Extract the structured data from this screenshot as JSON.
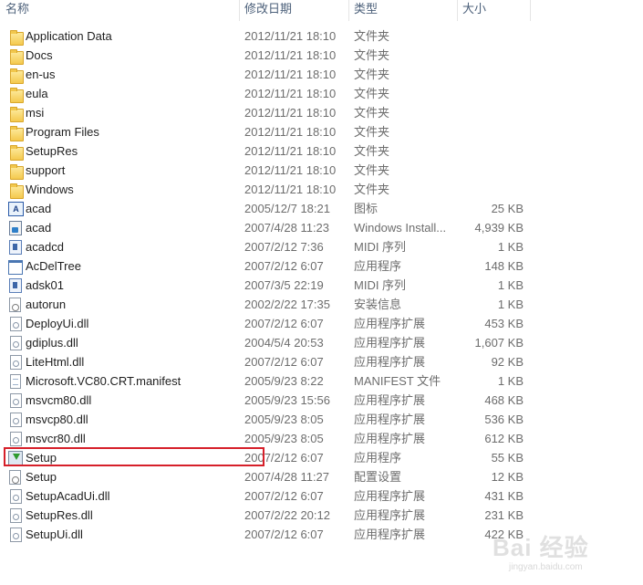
{
  "columns": {
    "name": "名称",
    "date": "修改日期",
    "type": "类型",
    "size": "大小"
  },
  "files": [
    {
      "name": "Application Data",
      "date": "2012/11/21 18:10",
      "type": "文件夹",
      "size": "",
      "icon": "folder-icon"
    },
    {
      "name": "Docs",
      "date": "2012/11/21 18:10",
      "type": "文件夹",
      "size": "",
      "icon": "folder-icon"
    },
    {
      "name": "en-us",
      "date": "2012/11/21 18:10",
      "type": "文件夹",
      "size": "",
      "icon": "folder-icon"
    },
    {
      "name": "eula",
      "date": "2012/11/21 18:10",
      "type": "文件夹",
      "size": "",
      "icon": "folder-icon"
    },
    {
      "name": "msi",
      "date": "2012/11/21 18:10",
      "type": "文件夹",
      "size": "",
      "icon": "folder-icon"
    },
    {
      "name": "Program Files",
      "date": "2012/11/21 18:10",
      "type": "文件夹",
      "size": "",
      "icon": "folder-icon"
    },
    {
      "name": "SetupRes",
      "date": "2012/11/21 18:10",
      "type": "文件夹",
      "size": "",
      "icon": "folder-icon"
    },
    {
      "name": "support",
      "date": "2012/11/21 18:10",
      "type": "文件夹",
      "size": "",
      "icon": "folder-icon"
    },
    {
      "name": "Windows",
      "date": "2012/11/21 18:10",
      "type": "文件夹",
      "size": "",
      "icon": "folder-icon"
    },
    {
      "name": "acad",
      "date": "2005/12/7 18:21",
      "type": "图标",
      "size": "25 KB",
      "icon": "acad-icon"
    },
    {
      "name": "acad",
      "date": "2007/4/28 11:23",
      "type": "Windows Install...",
      "size": "4,939 KB",
      "icon": "installer-icon"
    },
    {
      "name": "acadcd",
      "date": "2007/2/12 7:36",
      "type": "MIDI 序列",
      "size": "1 KB",
      "icon": "midi-icon"
    },
    {
      "name": "AcDelTree",
      "date": "2007/2/12 6:07",
      "type": "应用程序",
      "size": "148 KB",
      "icon": "application-icon"
    },
    {
      "name": "adsk01",
      "date": "2007/3/5 22:19",
      "type": "MIDI 序列",
      "size": "1 KB",
      "icon": "midi-icon"
    },
    {
      "name": "autorun",
      "date": "2002/2/22 17:35",
      "type": "安装信息",
      "size": "1 KB",
      "icon": "setup-info-icon"
    },
    {
      "name": "DeployUi.dll",
      "date": "2007/2/12 6:07",
      "type": "应用程序扩展",
      "size": "453 KB",
      "icon": "dll-icon"
    },
    {
      "name": "gdiplus.dll",
      "date": "2004/5/4 20:53",
      "type": "应用程序扩展",
      "size": "1,607 KB",
      "icon": "dll-icon"
    },
    {
      "name": "LiteHtml.dll",
      "date": "2007/2/12 6:07",
      "type": "应用程序扩展",
      "size": "92 KB",
      "icon": "dll-icon"
    },
    {
      "name": "Microsoft.VC80.CRT.manifest",
      "date": "2005/9/23 8:22",
      "type": "MANIFEST 文件",
      "size": "1 KB",
      "icon": "document-icon"
    },
    {
      "name": "msvcm80.dll",
      "date": "2005/9/23 15:56",
      "type": "应用程序扩展",
      "size": "468 KB",
      "icon": "dll-icon"
    },
    {
      "name": "msvcp80.dll",
      "date": "2005/9/23 8:05",
      "type": "应用程序扩展",
      "size": "536 KB",
      "icon": "dll-icon"
    },
    {
      "name": "msvcr80.dll",
      "date": "2005/9/23 8:05",
      "type": "应用程序扩展",
      "size": "612 KB",
      "icon": "dll-icon"
    },
    {
      "name": "Setup",
      "date": "2007/2/12 6:07",
      "type": "应用程序",
      "size": "55 KB",
      "icon": "setup-icon"
    },
    {
      "name": "Setup",
      "date": "2007/4/28 11:27",
      "type": "配置设置",
      "size": "12 KB",
      "icon": "config-icon"
    },
    {
      "name": "SetupAcadUi.dll",
      "date": "2007/2/12 6:07",
      "type": "应用程序扩展",
      "size": "431 KB",
      "icon": "dll-icon"
    },
    {
      "name": "SetupRes.dll",
      "date": "2007/2/22 20:12",
      "type": "应用程序扩展",
      "size": "231 KB",
      "icon": "dll-icon"
    },
    {
      "name": "SetupUi.dll",
      "date": "2007/2/12 6:07",
      "type": "应用程序扩展",
      "size": "422 KB",
      "icon": "dll-icon"
    }
  ],
  "watermark": {
    "main": "Bai 经验",
    "sub": "jingyan.baidu.com"
  },
  "colors": {
    "highlight_border": "#d6202a",
    "header_text": "#4c607a",
    "secondary_text": "#6d6d6d"
  }
}
